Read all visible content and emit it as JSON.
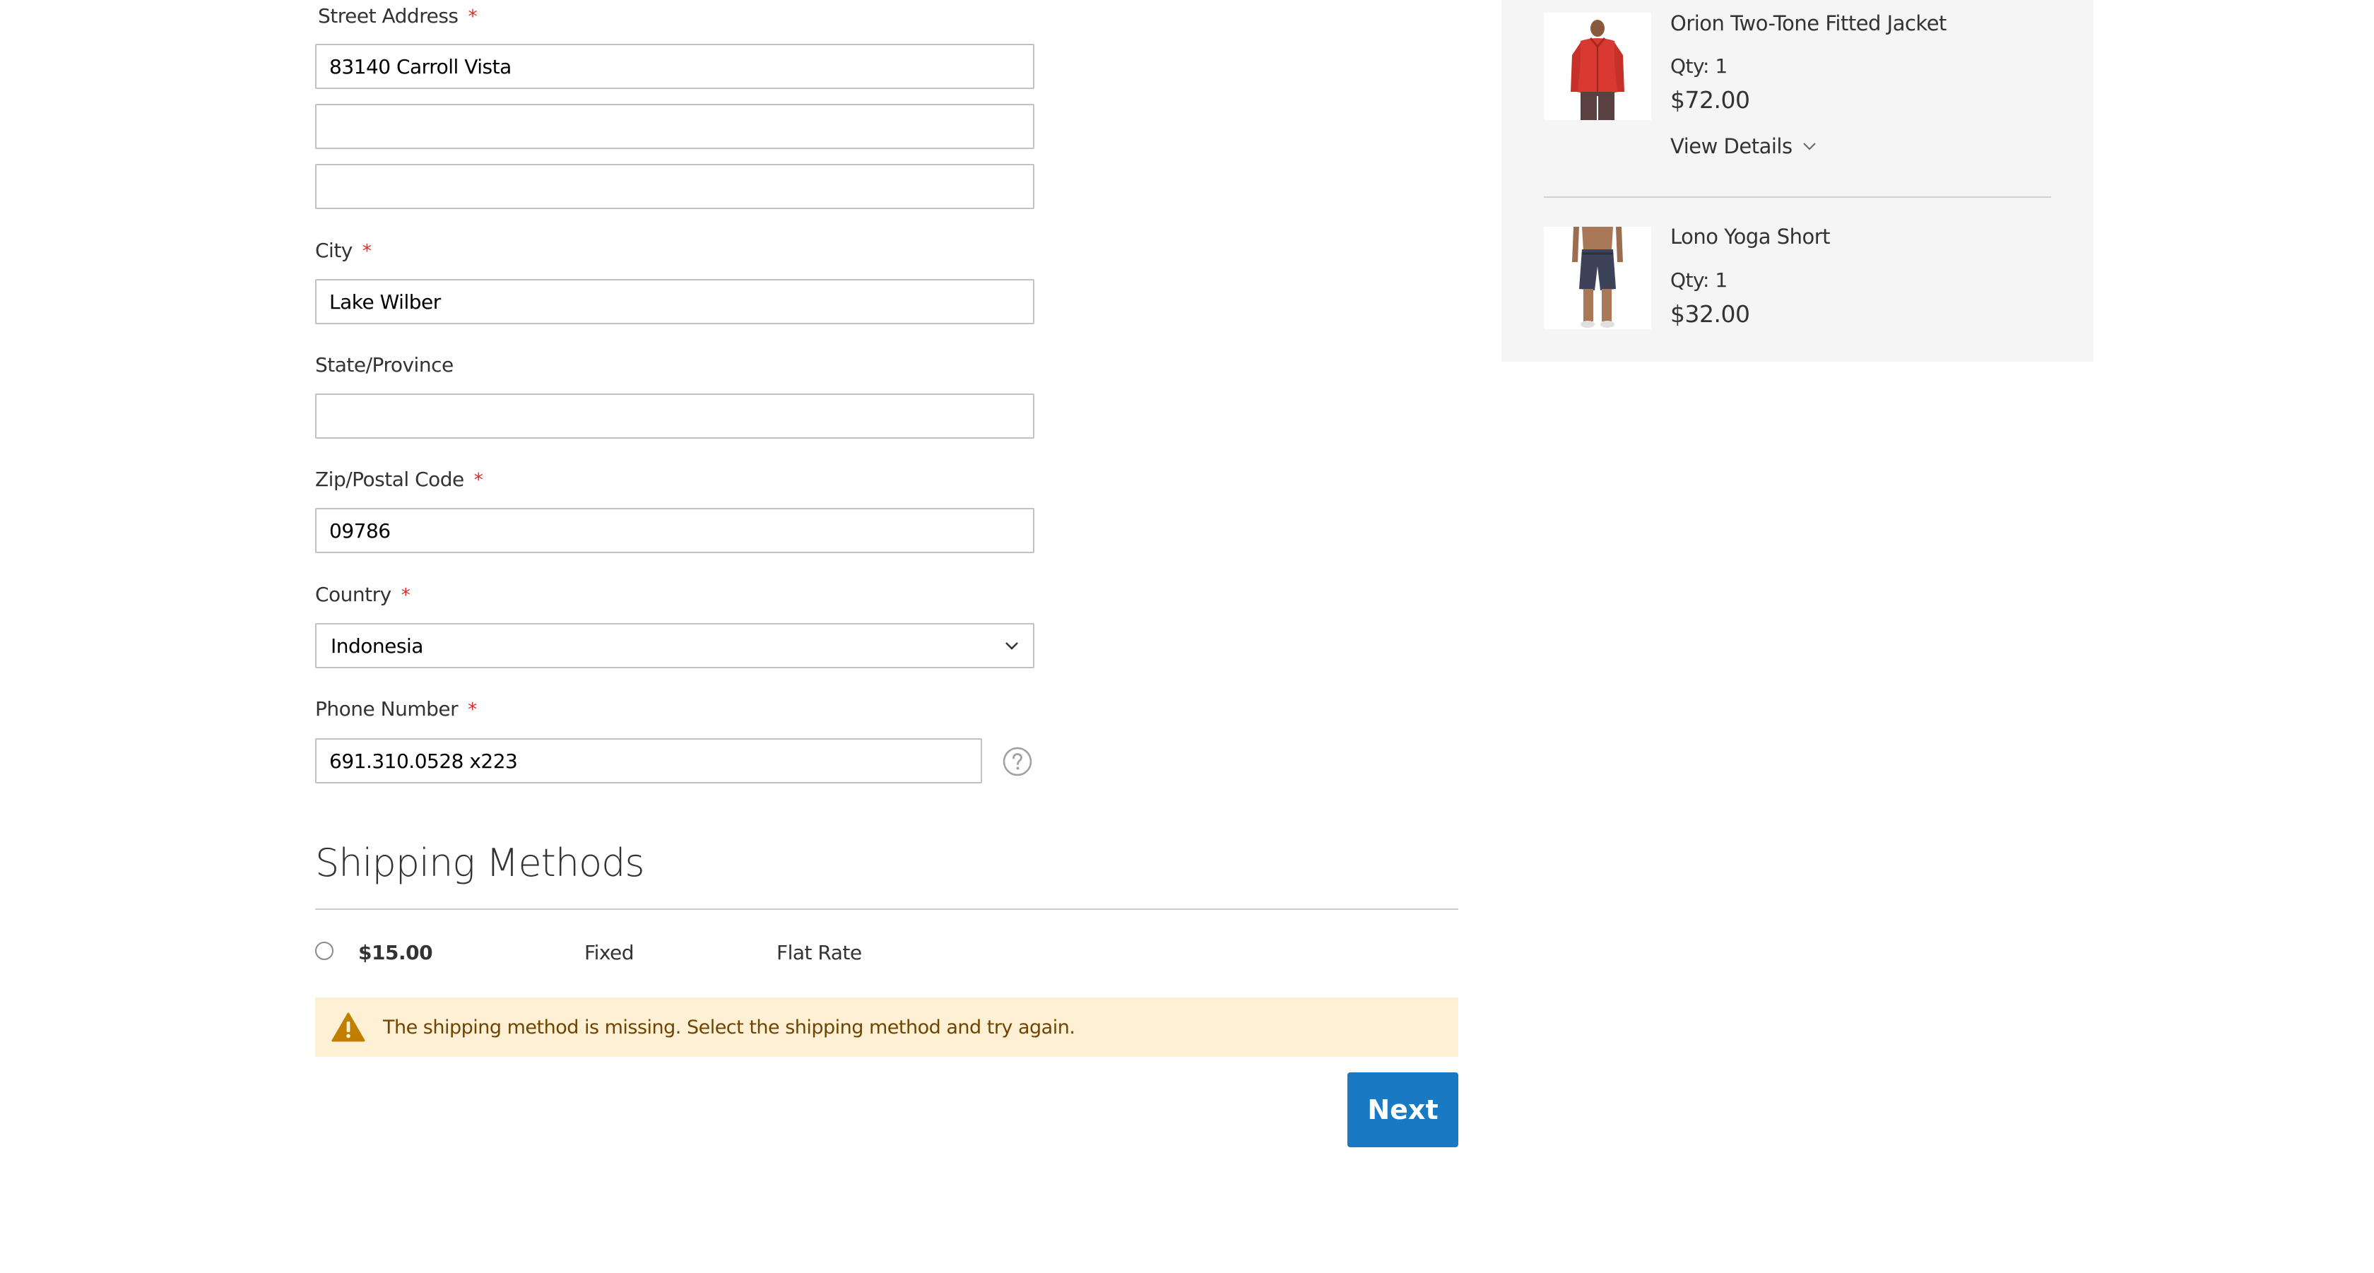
{
  "form": {
    "street_address": {
      "label": "Street Address",
      "required_marker": "*",
      "line1_value": "83140 Carroll Vista",
      "line2_value": "",
      "line3_value": ""
    },
    "city": {
      "label": "City",
      "required_marker": "*",
      "value": "Lake Wilber"
    },
    "state": {
      "label": "State/Province",
      "value": ""
    },
    "zip": {
      "label": "Zip/Postal Code",
      "required_marker": "*",
      "value": "09786"
    },
    "country": {
      "label": "Country",
      "required_marker": "*",
      "selected": "Indonesia"
    },
    "phone": {
      "label": "Phone Number",
      "required_marker": "*",
      "value": "691.310.0528 x223"
    }
  },
  "shipping_methods": {
    "title": "Shipping Methods",
    "rows": [
      {
        "price": "$15.00",
        "method": "Fixed",
        "carrier": "Flat Rate"
      }
    ],
    "warning": "The shipping method is missing. Select the shipping method and try again.",
    "next_label": "Next"
  },
  "summary": {
    "items": [
      {
        "name": "Orion Two-Tone Fitted Jacket",
        "qty": "Qty: 1",
        "price": "$72.00",
        "details_label": "View Details"
      },
      {
        "name": "Lono Yoga Short",
        "qty": "Qty: 1",
        "price": "$32.00"
      }
    ]
  },
  "colors": {
    "required": "#e02b27",
    "primary_button": "#1979c3",
    "warning_bg": "#fdf0d5",
    "warning_text": "#6f4400",
    "sidebar_bg": "#f5f5f5"
  }
}
